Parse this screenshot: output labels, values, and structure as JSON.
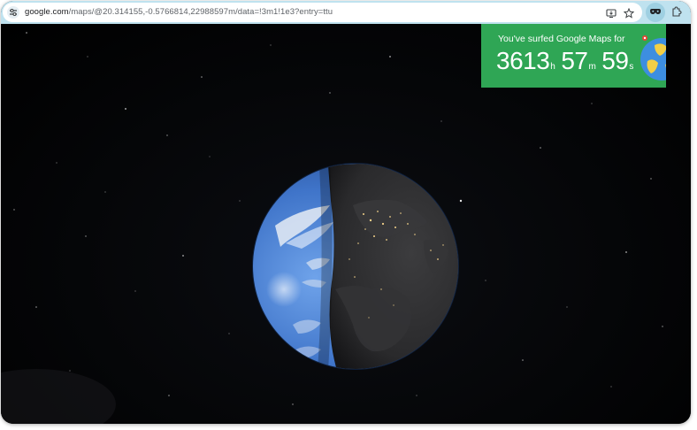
{
  "browser": {
    "url_host": "google.com",
    "url_path": "/maps/@20.314155,-0.5766814,22988597m/data=!3m1!1e3?entry=ttu",
    "icons": {
      "site_info": "tune-icon",
      "install": "install-app-icon",
      "bookmark": "star-icon",
      "extension": "extension-mask-icon",
      "extensions_menu": "puzzle-icon"
    }
  },
  "widget": {
    "caption_prefix": "You've surfed ",
    "caption_brand": "Google Maps",
    "caption_suffix": " for",
    "hours": "3613",
    "hours_unit": "h",
    "minutes": "57",
    "minutes_unit": "m",
    "seconds": "59",
    "seconds_unit": "s",
    "background_color": "#2fa655"
  },
  "map": {
    "view": "satellite-globe"
  }
}
